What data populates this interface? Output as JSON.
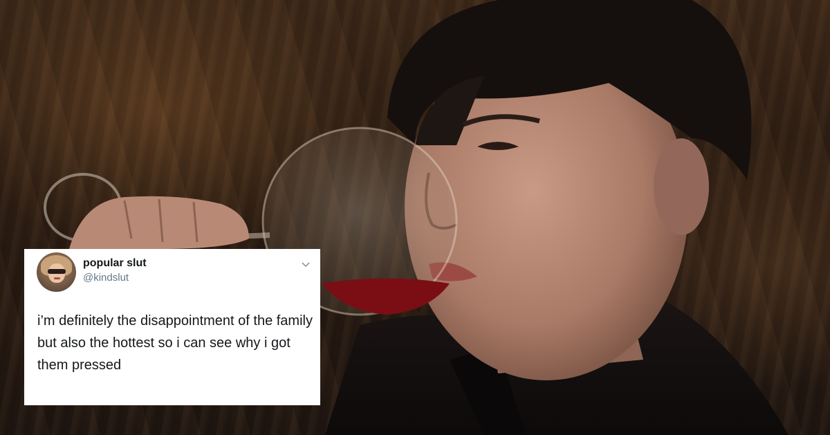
{
  "tweet": {
    "display_name": "popular slut",
    "handle": "@kindslut",
    "text": "i’m definitely the disappointment of the family but also the hottest so i can see why i got them pressed",
    "menu_icon": "chevron-down-icon",
    "avatar": "avatar"
  },
  "background": {
    "subject": "man drinking red wine from a large glass"
  },
  "colors": {
    "card_bg": "#ffffff",
    "name_text": "#14171a",
    "handle_text": "#657786",
    "wine": "#7a0e14"
  }
}
